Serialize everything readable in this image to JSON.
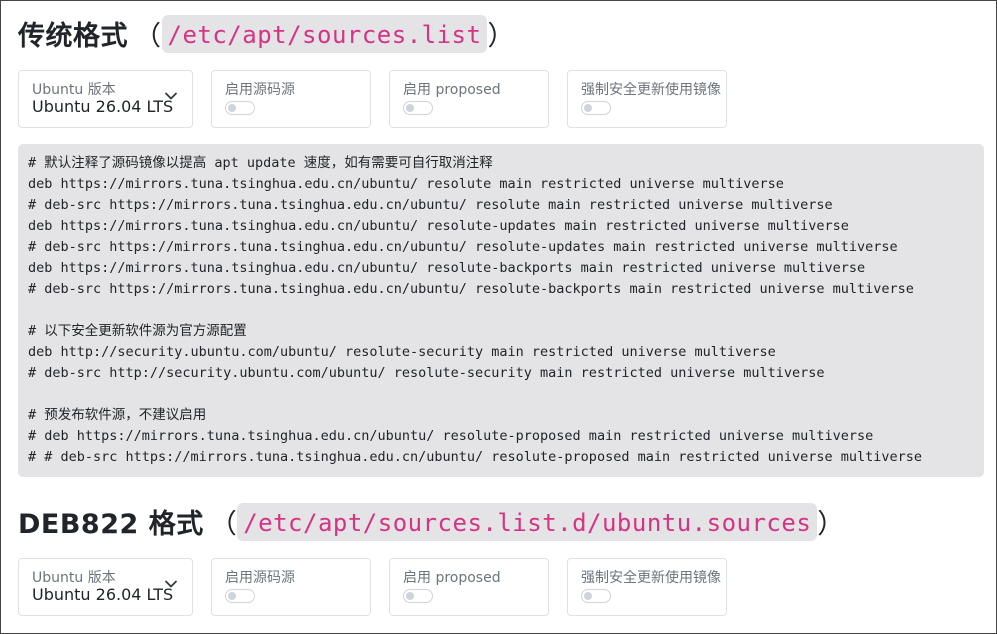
{
  "section1": {
    "title": "传统格式",
    "paren_open": "（",
    "path": "/etc/apt/sources.list",
    "paren_close": "）"
  },
  "section2": {
    "title": "DEB822 格式",
    "paren_open": "（",
    "path": "/etc/apt/sources.list.d/ubuntu.sources",
    "paren_close": "）"
  },
  "controls": {
    "version_label": "Ubuntu 版本",
    "version_value": "Ubuntu 26.04 LTS",
    "source_code_label": "启用源码源",
    "source_code_enabled": false,
    "proposed_label": "启用 proposed",
    "proposed_enabled": false,
    "security_mirror_label": "强制安全更新使用镜像",
    "security_mirror_enabled": false
  },
  "code": {
    "lines": [
      "# 默认注释了源码镜像以提高 apt update 速度，如有需要可自行取消注释",
      "deb https://mirrors.tuna.tsinghua.edu.cn/ubuntu/ resolute main restricted universe multiverse",
      "# deb-src https://mirrors.tuna.tsinghua.edu.cn/ubuntu/ resolute main restricted universe multiverse",
      "deb https://mirrors.tuna.tsinghua.edu.cn/ubuntu/ resolute-updates main restricted universe multiverse",
      "# deb-src https://mirrors.tuna.tsinghua.edu.cn/ubuntu/ resolute-updates main restricted universe multiverse",
      "deb https://mirrors.tuna.tsinghua.edu.cn/ubuntu/ resolute-backports main restricted universe multiverse",
      "# deb-src https://mirrors.tuna.tsinghua.edu.cn/ubuntu/ resolute-backports main restricted universe multiverse",
      "",
      "# 以下安全更新软件源为官方源配置",
      "deb http://security.ubuntu.com/ubuntu/ resolute-security main restricted universe multiverse",
      "# deb-src http://security.ubuntu.com/ubuntu/ resolute-security main restricted universe multiverse",
      "",
      "# 预发布软件源，不建议启用",
      "# deb https://mirrors.tuna.tsinghua.edu.cn/ubuntu/ resolute-proposed main restricted universe multiverse",
      "# # deb-src https://mirrors.tuna.tsinghua.edu.cn/ubuntu/ resolute-proposed main restricted universe multiverse"
    ]
  },
  "colors": {
    "path_accent": "#d63384",
    "code_background": "#e4e4e6"
  },
  "icons": {
    "select_chevron": "chevron-down-icon"
  }
}
